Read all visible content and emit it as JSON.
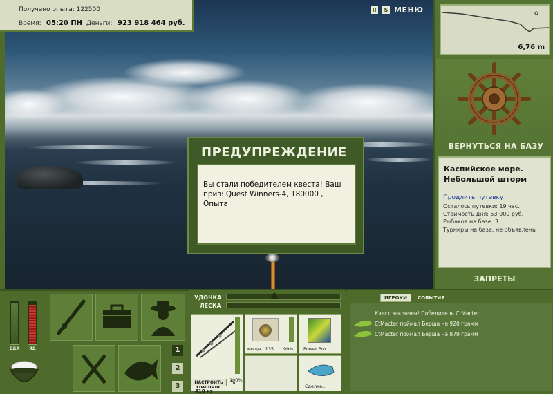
{
  "stats": {
    "xp_label": "Получено опыта: 122500",
    "time_label": "Время:",
    "time_value": "05:20 ПН",
    "money_label": "Деньги:",
    "money_value": "923 918 464 руб."
  },
  "top_icons": {
    "pause": "II",
    "sound": "S",
    "menu": "МЕНЮ"
  },
  "depth": {
    "value": "6,76 m"
  },
  "base": {
    "return_label": "ВЕРНУТЬСЯ НА БАЗУ",
    "location": "Каспийское море. Небольшой шторм",
    "extend_link": "Продлить путевку",
    "lines": [
      "Осталось путевки: 19 час.",
      "Стоимость дня: 53 000 руб.",
      "Рыбаков на базе: 3",
      "Турниры на базе: не объявлены"
    ],
    "forbid_label": "ЗАПРЕТЫ"
  },
  "dialog": {
    "title": "ПРЕДУПРЕЖДЕНИЕ",
    "message": "Вы стали победителем квеста! Ваш приз: Quest Winners-4, 180000 , Опыта"
  },
  "needs": {
    "food_label": "ЕДА",
    "food_level": 0.95,
    "poison_label": "ЯД",
    "poison_level": 0.9
  },
  "quick_slots": [
    "1",
    "2",
    "3"
  ],
  "tackle": {
    "rod_label": "УДОЧКА",
    "line_label": "ЛЕСКА",
    "rod_name": "Titanium",
    "rod_weight": "410 кг",
    "rod_percent": "100%",
    "setup_button": "НАСТРОИТЬ",
    "reel_power": "мощн.: 135",
    "reel_percent": "99%",
    "line_name": "Power Pro...",
    "bait_name": "Сделка..."
  },
  "events": {
    "tab_players": "ИГРОКИ",
    "tab_events": "СОБЫТИЯ",
    "items": [
      "Квест закончен! Победитель CtMacter",
      "CtMacter поймал Берша на 920 грамм",
      "CtMacter поймал Берша на 879 грамм"
    ]
  },
  "colors": {
    "panel_green": "#4e6b2c",
    "text_light": "#eef2df",
    "link_blue": "#1a3a9c"
  }
}
